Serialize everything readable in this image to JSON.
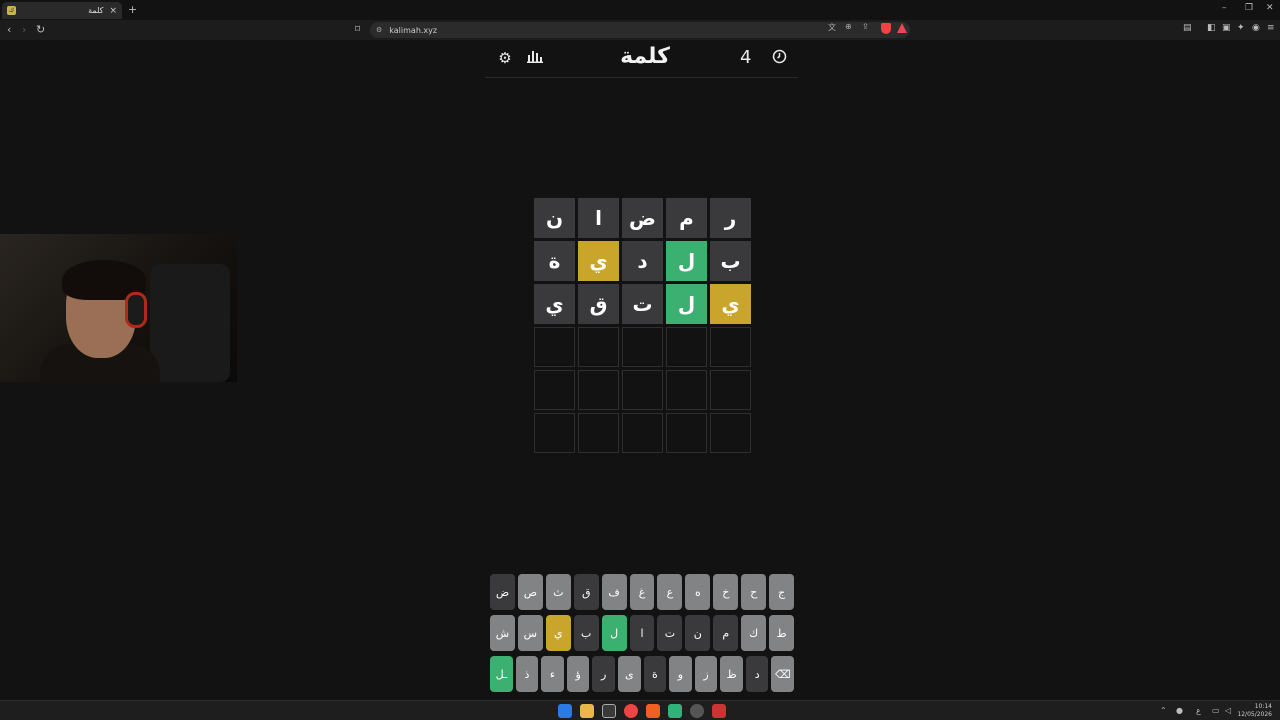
{
  "browser": {
    "tab_title": "كلمة",
    "tab_close": "×",
    "new_tab": "+",
    "url": "kalimah.xyz",
    "window_controls": [
      "–",
      "❐",
      "✕"
    ]
  },
  "header": {
    "title": "كلمة",
    "streak": "4",
    "icons": [
      "gear-icon",
      "stats-icon",
      "timer-icon"
    ]
  },
  "board": {
    "rows": [
      [
        {
          "l": "ر",
          "s": "absent"
        },
        {
          "l": "م",
          "s": "absent"
        },
        {
          "l": "ض",
          "s": "absent"
        },
        {
          "l": "ا",
          "s": "absent"
        },
        {
          "l": "ن",
          "s": "absent"
        }
      ],
      [
        {
          "l": "ب",
          "s": "absent"
        },
        {
          "l": "ل",
          "s": "correct"
        },
        {
          "l": "د",
          "s": "absent"
        },
        {
          "l": "ي",
          "s": "present"
        },
        {
          "l": "ة",
          "s": "absent"
        }
      ],
      [
        {
          "l": "ي",
          "s": "present"
        },
        {
          "l": "ل",
          "s": "correct"
        },
        {
          "l": "ت",
          "s": "absent"
        },
        {
          "l": "ق",
          "s": "absent"
        },
        {
          "l": "ي",
          "s": "absent"
        }
      ],
      [
        {
          "l": "",
          "s": "empty"
        },
        {
          "l": "",
          "s": "empty"
        },
        {
          "l": "",
          "s": "empty"
        },
        {
          "l": "",
          "s": "empty"
        },
        {
          "l": "",
          "s": "empty"
        }
      ],
      [
        {
          "l": "",
          "s": "empty"
        },
        {
          "l": "",
          "s": "empty"
        },
        {
          "l": "",
          "s": "empty"
        },
        {
          "l": "",
          "s": "empty"
        },
        {
          "l": "",
          "s": "empty"
        }
      ],
      [
        {
          "l": "",
          "s": "empty"
        },
        {
          "l": "",
          "s": "empty"
        },
        {
          "l": "",
          "s": "empty"
        },
        {
          "l": "",
          "s": "empty"
        },
        {
          "l": "",
          "s": "empty"
        }
      ]
    ]
  },
  "keyboard": {
    "rows": [
      [
        {
          "k": "ج",
          "s": "unused"
        },
        {
          "k": "ح",
          "s": "unused"
        },
        {
          "k": "خ",
          "s": "unused"
        },
        {
          "k": "ه",
          "s": "unused"
        },
        {
          "k": "ع",
          "s": "unused"
        },
        {
          "k": "غ",
          "s": "unused"
        },
        {
          "k": "ف",
          "s": "unused"
        },
        {
          "k": "ق",
          "s": "absent"
        },
        {
          "k": "ث",
          "s": "unused"
        },
        {
          "k": "ص",
          "s": "unused"
        },
        {
          "k": "ض",
          "s": "absent"
        }
      ],
      [
        {
          "k": "ط",
          "s": "unused"
        },
        {
          "k": "ك",
          "s": "unused"
        },
        {
          "k": "م",
          "s": "absent"
        },
        {
          "k": "ن",
          "s": "absent"
        },
        {
          "k": "ت",
          "s": "absent"
        },
        {
          "k": "ا",
          "s": "absent"
        },
        {
          "k": "ل",
          "s": "correct"
        },
        {
          "k": "ب",
          "s": "absent"
        },
        {
          "k": "ي",
          "s": "present"
        },
        {
          "k": "س",
          "s": "unused"
        },
        {
          "k": "ش",
          "s": "unused"
        }
      ],
      [
        {
          "k": "⌫",
          "s": "unused"
        },
        {
          "k": "د",
          "s": "absent"
        },
        {
          "k": "ظ",
          "s": "unused"
        },
        {
          "k": "ز",
          "s": "unused"
        },
        {
          "k": "و",
          "s": "unused"
        },
        {
          "k": "ة",
          "s": "absent"
        },
        {
          "k": "ى",
          "s": "unused"
        },
        {
          "k": "ر",
          "s": "absent"
        },
        {
          "k": "ؤ",
          "s": "unused"
        },
        {
          "k": "ء",
          "s": "unused"
        },
        {
          "k": "ذ",
          "s": "unused"
        },
        {
          "k": "ـل",
          "s": "correct"
        }
      ]
    ]
  },
  "colors": {
    "absent": "#3a3a3c",
    "present": "#c9a52c",
    "correct": "#3bb071",
    "unused": "#818384"
  },
  "taskbar": {
    "time": "10:14",
    "date": "12/05/2026",
    "lang": "ع"
  }
}
